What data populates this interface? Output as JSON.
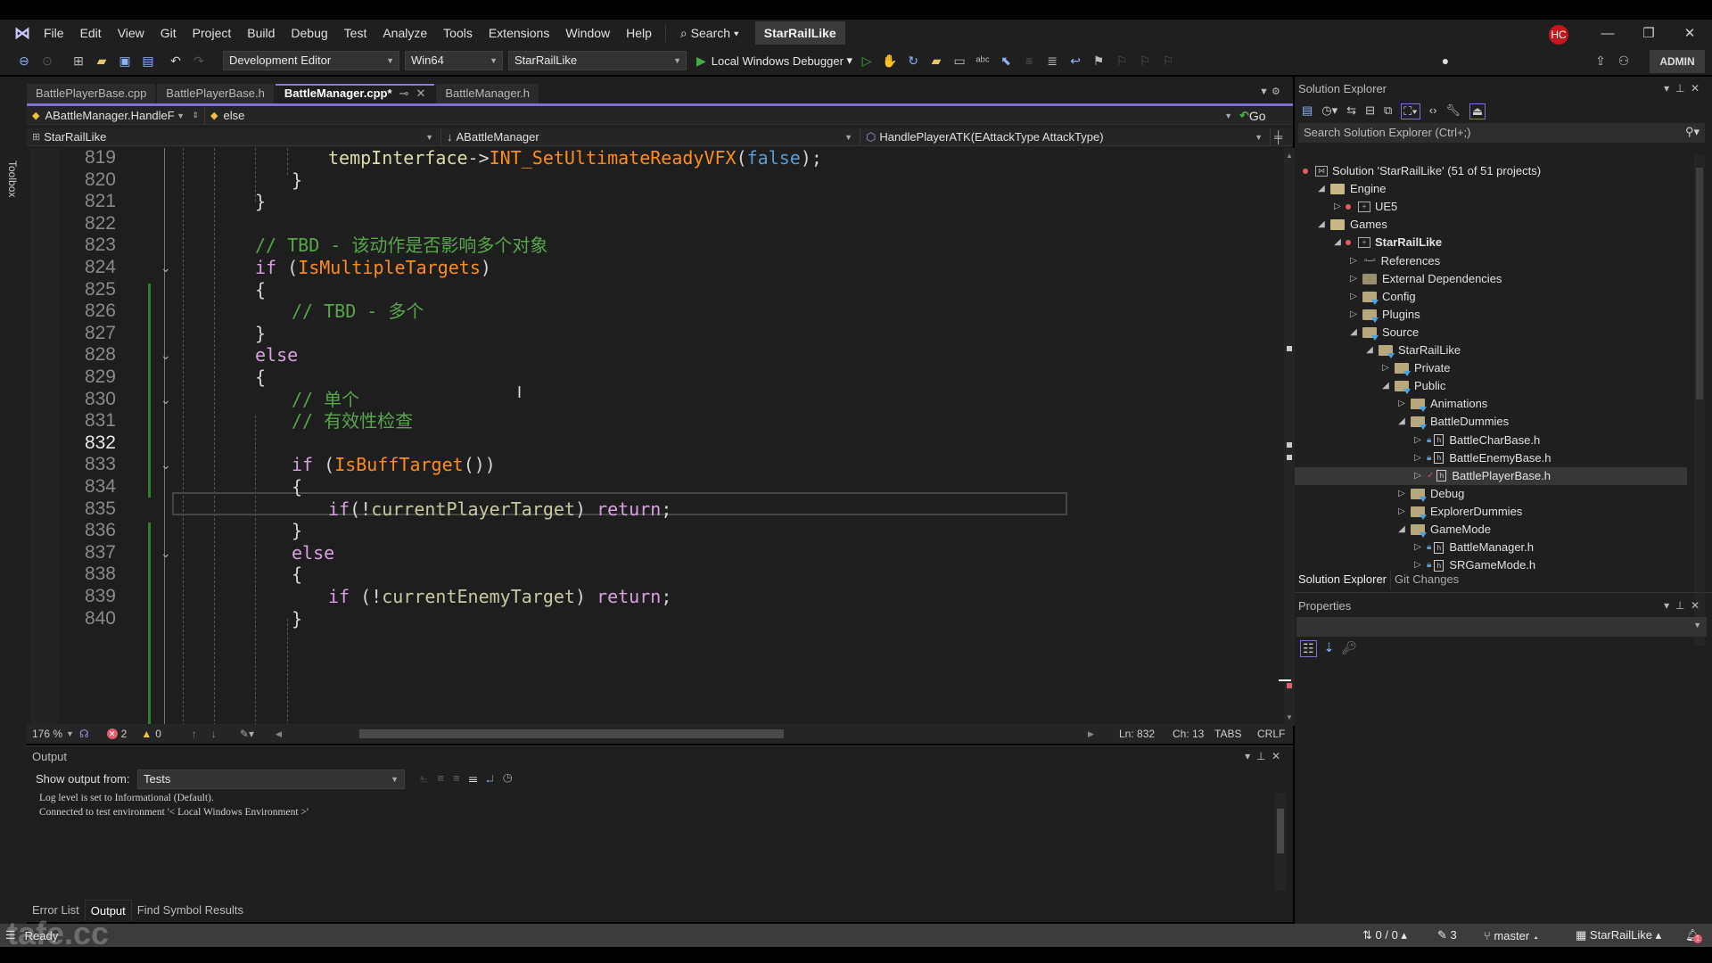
{
  "menubar": {
    "items": [
      "File",
      "Edit",
      "View",
      "Git",
      "Project",
      "Build",
      "Debug",
      "Test",
      "Analyze",
      "Tools",
      "Extensions",
      "Window",
      "Help"
    ],
    "search_label": "Search",
    "solution_name": "StarRailLike",
    "user_initials": "HC"
  },
  "toolbar": {
    "config": "Development Editor",
    "platform": "Win64",
    "startup_project": "StarRailLike",
    "debugger": "Local Windows Debugger",
    "admin_label": "ADMIN"
  },
  "toolbox_label": "Toolbox",
  "tabs": [
    {
      "label": "BattlePlayerBase.cpp",
      "active": false
    },
    {
      "label": "BattlePlayerBase.h",
      "active": false
    },
    {
      "label": "BattleManager.cpp*",
      "active": true
    },
    {
      "label": "BattleManager.h",
      "active": false
    }
  ],
  "nav": {
    "scope": "ABattleManager.HandleF",
    "block": "else",
    "go_label": "Go",
    "project": "StarRailLike",
    "class": "ABattleManager",
    "member": "HandlePlayerATK(EAttackType AttackType)"
  },
  "code": {
    "lines": [
      {
        "n": "819",
        "indent": 3,
        "tokens": [
          [
            "var",
            "tempInterface"
          ],
          [
            "",
            "->"
          ],
          [
            "fn",
            "INT_SetUltimateReadyVFX"
          ],
          [
            "",
            "("
          ],
          [
            "bool",
            "false"
          ],
          [
            "",
            ");"
          ]
        ]
      },
      {
        "n": "820",
        "indent": 2,
        "tokens": [
          [
            "",
            "}"
          ]
        ]
      },
      {
        "n": "821",
        "indent": 1,
        "tokens": [
          [
            "",
            "}"
          ]
        ]
      },
      {
        "n": "822",
        "indent": 1,
        "tokens": []
      },
      {
        "n": "823",
        "indent": 1,
        "tokens": [
          [
            "cm",
            "// TBD - 该动作是否影响多个对象"
          ]
        ]
      },
      {
        "n": "824",
        "indent": 1,
        "tokens": [
          [
            "kw",
            "if"
          ],
          [
            "",
            " ("
          ],
          [
            "fn",
            "IsMultipleTargets"
          ],
          [
            "",
            ")"
          ]
        ]
      },
      {
        "n": "825",
        "indent": 1,
        "tokens": [
          [
            "",
            "{"
          ]
        ]
      },
      {
        "n": "826",
        "indent": 2,
        "tokens": [
          [
            "cm",
            "// TBD - 多个"
          ]
        ]
      },
      {
        "n": "827",
        "indent": 1,
        "tokens": [
          [
            "",
            "}"
          ]
        ]
      },
      {
        "n": "828",
        "indent": 1,
        "tokens": [
          [
            "kw",
            "else"
          ]
        ]
      },
      {
        "n": "829",
        "indent": 1,
        "tokens": [
          [
            "",
            "{"
          ]
        ]
      },
      {
        "n": "830",
        "indent": 2,
        "tokens": [
          [
            "cm",
            "// 单个"
          ]
        ]
      },
      {
        "n": "831",
        "indent": 2,
        "tokens": [
          [
            "cm",
            "// 有效性检查"
          ]
        ]
      },
      {
        "n": "832",
        "indent": 2,
        "tokens": []
      },
      {
        "n": "833",
        "indent": 2,
        "tokens": [
          [
            "kw",
            "if"
          ],
          [
            "",
            " ("
          ],
          [
            "fn",
            "IsBuffTarget"
          ],
          [
            "",
            "())"
          ]
        ]
      },
      {
        "n": "834",
        "indent": 2,
        "tokens": [
          [
            "",
            "{"
          ]
        ]
      },
      {
        "n": "835",
        "indent": 3,
        "tokens": [
          [
            "kw",
            "if"
          ],
          [
            "",
            "(!"
          ],
          [
            "var2",
            "currentPlayerTarget"
          ],
          [
            "",
            ") "
          ],
          [
            "kw",
            "return"
          ],
          [
            "",
            ";"
          ]
        ]
      },
      {
        "n": "836",
        "indent": 2,
        "tokens": [
          [
            "",
            "}"
          ]
        ]
      },
      {
        "n": "837",
        "indent": 2,
        "tokens": [
          [
            "kw",
            "else"
          ]
        ]
      },
      {
        "n": "838",
        "indent": 2,
        "tokens": [
          [
            "",
            "{"
          ]
        ]
      },
      {
        "n": "839",
        "indent": 3,
        "tokens": [
          [
            "kw",
            "if"
          ],
          [
            "",
            " (!"
          ],
          [
            "var2",
            "currentEnemyTarget"
          ],
          [
            "",
            ") "
          ],
          [
            "kw",
            "return"
          ],
          [
            "",
            ";"
          ]
        ]
      },
      {
        "n": "840",
        "indent": 2,
        "tokens": [
          [
            "",
            "}"
          ]
        ]
      }
    ],
    "current_line": "832"
  },
  "editor_status": {
    "zoom": "176 %",
    "errors": "2",
    "warnings": "0",
    "line": "Ln: 832",
    "col": "Ch: 13",
    "indent": "TABS",
    "eol": "CRLF"
  },
  "output": {
    "title": "Output",
    "show_from_label": "Show output from:",
    "source": "Tests",
    "text": "Log level is set to Informational (Default).\nConnected to test environment '< Local Windows Environment >'"
  },
  "bottom_tabs": [
    {
      "label": "Error List",
      "active": false
    },
    {
      "label": "Output",
      "active": true
    },
    {
      "label": "Find Symbol Results",
      "active": false
    }
  ],
  "statusbar": {
    "state": "Ready",
    "sync": "0 / 0",
    "edits": "3",
    "branch": "master",
    "repo": "StarRailLike",
    "notifications": "1"
  },
  "solution_explorer": {
    "title": "Solution Explorer",
    "search_placeholder": "Search Solution Explorer (Ctrl+;)",
    "tree": [
      {
        "label": "Solution 'StarRailLike' (51 of 51 projects)",
        "level": 0,
        "type": "solution",
        "expander": "",
        "bold": false
      },
      {
        "label": "Engine",
        "level": 1,
        "type": "folder",
        "expander": "open"
      },
      {
        "label": "UE5",
        "level": 2,
        "type": "project",
        "expander": "closed"
      },
      {
        "label": "Games",
        "level": 1,
        "type": "folder",
        "expander": "open"
      },
      {
        "label": "StarRailLike",
        "level": 2,
        "type": "project",
        "expander": "open",
        "bold": true
      },
      {
        "label": "References",
        "level": 3,
        "type": "refs",
        "expander": "closed"
      },
      {
        "label": "External Dependencies",
        "level": 3,
        "type": "extdeps",
        "expander": "closed"
      },
      {
        "label": "Config",
        "level": 3,
        "type": "filter",
        "expander": "closed"
      },
      {
        "label": "Plugins",
        "level": 3,
        "type": "filter",
        "expander": "closed"
      },
      {
        "label": "Source",
        "level": 3,
        "type": "filter",
        "expander": "open"
      },
      {
        "label": "StarRailLike",
        "level": 4,
        "type": "filter",
        "expander": "open"
      },
      {
        "label": "Private",
        "level": 5,
        "type": "filter",
        "expander": "closed"
      },
      {
        "label": "Public",
        "level": 5,
        "type": "filter",
        "expander": "open"
      },
      {
        "label": "Animations",
        "level": 6,
        "type": "filter",
        "expander": "closed"
      },
      {
        "label": "BattleDummies",
        "level": 6,
        "type": "filter",
        "expander": "open"
      },
      {
        "label": "BattleCharBase.h",
        "level": 7,
        "type": "file",
        "expander": "closed",
        "status": "lock"
      },
      {
        "label": "BattleEnemyBase.h",
        "level": 7,
        "type": "file",
        "expander": "closed",
        "status": "lock"
      },
      {
        "label": "BattlePlayerBase.h",
        "level": 7,
        "type": "file",
        "expander": "closed",
        "status": "modified",
        "selected": true
      },
      {
        "label": "Debug",
        "level": 6,
        "type": "filter",
        "expander": "closed"
      },
      {
        "label": "ExplorerDummies",
        "level": 6,
        "type": "filter",
        "expander": "closed"
      },
      {
        "label": "GameMode",
        "level": 6,
        "type": "filter",
        "expander": "open"
      },
      {
        "label": "BattleManager.h",
        "level": 7,
        "type": "file",
        "expander": "closed",
        "status": "lock"
      },
      {
        "label": "SRGameMode.h",
        "level": 7,
        "type": "file",
        "expander": "closed",
        "status": "lock"
      }
    ],
    "bottom_tabs": [
      "Solution Explorer",
      "Git Changes"
    ]
  },
  "properties": {
    "title": "Properties"
  },
  "watermark": "tafe.cc",
  "colors": {
    "accent": "#7e6fd0",
    "keyword": "#d8a0df",
    "function": "#ff8c1a",
    "comment": "#57a64a",
    "error": "#e35c6f"
  }
}
